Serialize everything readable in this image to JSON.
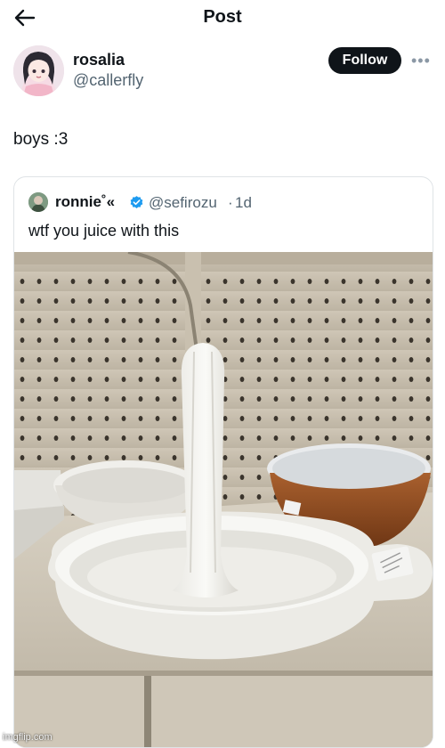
{
  "header": {
    "title": "Post"
  },
  "post": {
    "author_name": "rosalia",
    "author_handle": "@callerfly",
    "follow_label": "Follow",
    "more_label": "•••",
    "text": "boys :3"
  },
  "quote": {
    "author_name": "ronnie˚«",
    "author_handle": "@sefirozu",
    "separator": "·",
    "time": "1d",
    "text": "wtf you juice with this"
  },
  "watermark": "imgflip.com",
  "icons": {
    "back": "arrow-left-icon",
    "verified": "verified-badge-icon",
    "more": "more-horizontal-icon"
  },
  "colors": {
    "follow_bg": "#0f1419",
    "secondary_text": "#536471",
    "verified": "#1d9bf0"
  }
}
